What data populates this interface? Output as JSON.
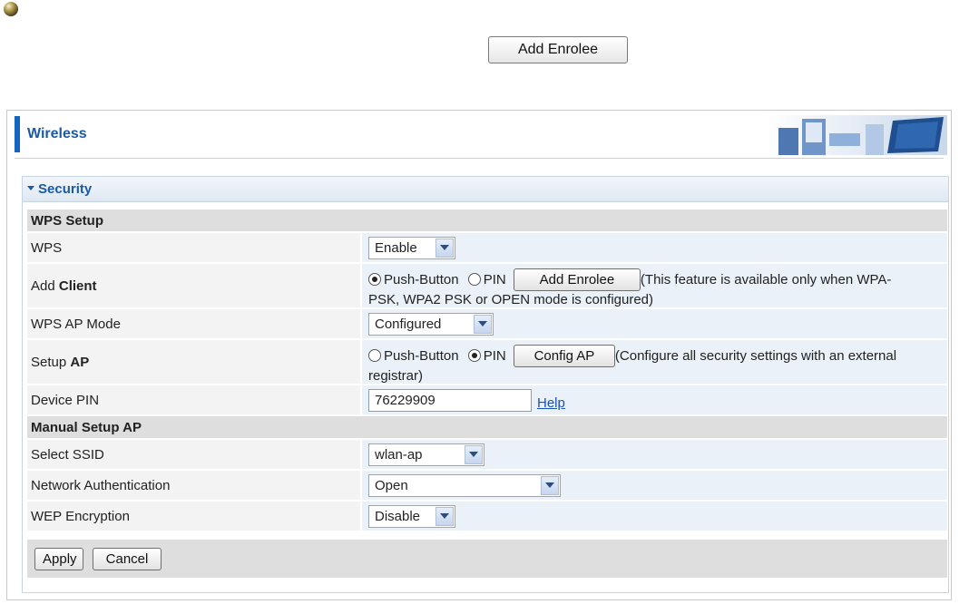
{
  "top": {
    "add_enrolee": "Add Enrolee"
  },
  "panel": {
    "title": "Wireless"
  },
  "section": {
    "title": "Security",
    "wps_setup": "WPS Setup",
    "manual_setup": "Manual Setup AP",
    "wps": {
      "label": "WPS",
      "value": "Enable"
    },
    "add_client": {
      "label_prefix": "Add ",
      "label_bold": "Client",
      "opt_push": "Push-Button",
      "opt_pin": "PIN",
      "button": "Add Enrolee",
      "note_line1": "(This feature is available only when WPA-",
      "note_line2": "PSK, WPA2 PSK or OPEN mode is configured)"
    },
    "ap_mode": {
      "label": "WPS AP Mode",
      "value": "Configured"
    },
    "setup_ap": {
      "label_prefix": "Setup ",
      "label_bold": "AP",
      "opt_push": "Push-Button",
      "opt_pin": "PIN",
      "button": "Config AP",
      "note_line1": "(Configure all security settings with an external",
      "note_line2": "registrar)"
    },
    "device_pin": {
      "label": "Device PIN",
      "value": "76229909",
      "help": "Help"
    },
    "ssid": {
      "label": "Select SSID",
      "value": "wlan-ap"
    },
    "auth": {
      "label": "Network Authentication",
      "value": "Open"
    },
    "wep": {
      "label": "WEP Encryption",
      "value": "Disable"
    },
    "apply": "Apply",
    "cancel": "Cancel"
  }
}
